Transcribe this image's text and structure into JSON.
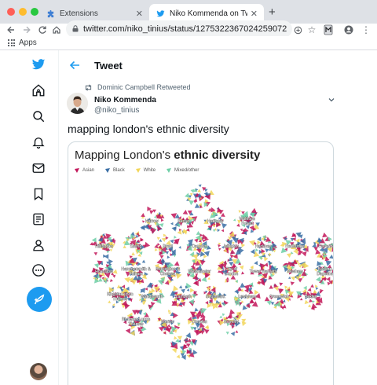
{
  "browser": {
    "tabs": [
      {
        "title": "Extensions",
        "icon": "puzzle-icon"
      },
      {
        "title": "Niko Kommenda on Twitter: \"m",
        "icon": "twitter-bird-icon"
      }
    ],
    "url": "twitter.com/niko_tinius/status/1275322367024259072",
    "bookmarks_label": "Apps"
  },
  "twitter": {
    "header_title": "Tweet",
    "retweeted_by": "Dominic Campbell Retweeted",
    "author_name": "Niko Kommenda",
    "author_handle": "@niko_tinius",
    "tweet_text": "mapping london's ethnic diversity",
    "nav_icons": [
      "twitter-logo-icon",
      "home-icon",
      "explore-icon",
      "notifications-icon",
      "messages-icon",
      "bookmarks-icon",
      "lists-icon",
      "profile-icon",
      "more-icon"
    ],
    "accent_color": "#1d9bf0"
  },
  "card": {
    "title_prefix": "Mapping London's ",
    "title_bold": "ethnic diversity",
    "legend": [
      {
        "label": "Asian",
        "color": "#c2185b"
      },
      {
        "label": "Black",
        "color": "#3a6ea5"
      },
      {
        "label": "White",
        "color": "#f2d65a"
      },
      {
        "label": "Mixed/other",
        "color": "#6fcfa7"
      }
    ],
    "boroughs": [
      {
        "name": "",
        "row": 0,
        "col": 2
      },
      {
        "name": "Harrow",
        "row": 1,
        "col": 0.5
      },
      {
        "name": "Barnet",
        "row": 1,
        "col": 1.5
      },
      {
        "name": "Haringey",
        "row": 1,
        "col": 2.5
      },
      {
        "name": "Waltham Forest",
        "row": 1,
        "col": 3.5
      },
      {
        "name": "Hillingdon",
        "row": 2,
        "col": -1
      },
      {
        "name": "Ealing",
        "row": 2,
        "col": 0
      },
      {
        "name": "Brent",
        "row": 2,
        "col": 1
      },
      {
        "name": "Camden",
        "row": 2,
        "col": 2
      },
      {
        "name": "Islington",
        "row": 2,
        "col": 3
      },
      {
        "name": "Hackney",
        "row": 2,
        "col": 4
      },
      {
        "name": "Redbridge",
        "row": 2,
        "col": 5
      },
      {
        "name": "Havering",
        "row": 2,
        "col": 6
      },
      {
        "name": "Hounslow",
        "row": 3,
        "col": -1
      },
      {
        "name": "Hammersmith & Fulham",
        "row": 3,
        "col": 0
      },
      {
        "name": "Kensington & Chelsea",
        "row": 3,
        "col": 1
      },
      {
        "name": "Westminster",
        "row": 3,
        "col": 2
      },
      {
        "name": "City of London",
        "row": 3,
        "col": 3
      },
      {
        "name": "Tower Hamlets",
        "row": 3,
        "col": 4
      },
      {
        "name": "Newham",
        "row": 3,
        "col": 5
      },
      {
        "name": "Barking & Dagenham",
        "row": 3,
        "col": 6
      },
      {
        "name": "Kingston upon Thames",
        "row": 4,
        "col": -0.5
      },
      {
        "name": "Wandsworth",
        "row": 4,
        "col": 0.5
      },
      {
        "name": "Lambeth",
        "row": 4,
        "col": 1.5
      },
      {
        "name": "Southwark",
        "row": 4,
        "col": 2.5
      },
      {
        "name": "Lewisham",
        "row": 4,
        "col": 3.5
      },
      {
        "name": "Greenwich",
        "row": 4,
        "col": 4.5
      },
      {
        "name": "Bexley",
        "row": 4,
        "col": 5.5
      },
      {
        "name": "Richmond upon Thames",
        "row": 5,
        "col": 0
      },
      {
        "name": "Merton",
        "row": 5,
        "col": 1
      },
      {
        "name": "Croydon",
        "row": 5,
        "col": 2
      },
      {
        "name": "Bromley",
        "row": 5,
        "col": 3
      },
      {
        "name": "",
        "row": 6,
        "col": 1.5
      }
    ]
  }
}
